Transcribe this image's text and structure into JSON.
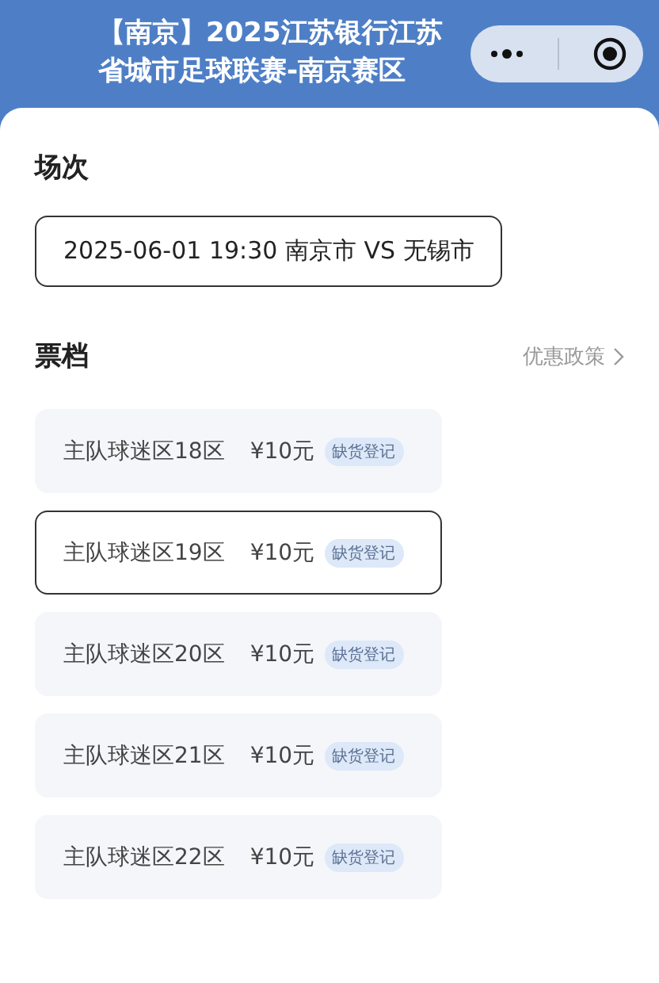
{
  "header": {
    "title": "【南京】2025江苏银行江苏省城市足球联赛-南京赛区"
  },
  "session": {
    "heading": "场次",
    "value": "2025-06-01 19:30 南京市 VS 无锡市"
  },
  "tiers": {
    "heading": "票档",
    "link": "优惠政策",
    "items": [
      {
        "name": "主队球迷区18区",
        "price": "¥10元",
        "badge": "缺货登记",
        "selected": false
      },
      {
        "name": "主队球迷区19区",
        "price": "¥10元",
        "badge": "缺货登记",
        "selected": true
      },
      {
        "name": "主队球迷区20区",
        "price": "¥10元",
        "badge": "缺货登记",
        "selected": false
      },
      {
        "name": "主队球迷区21区",
        "price": "¥10元",
        "badge": "缺货登记",
        "selected": false
      },
      {
        "name": "主队球迷区22区",
        "price": "¥10元",
        "badge": "缺货登记",
        "selected": false
      }
    ]
  }
}
